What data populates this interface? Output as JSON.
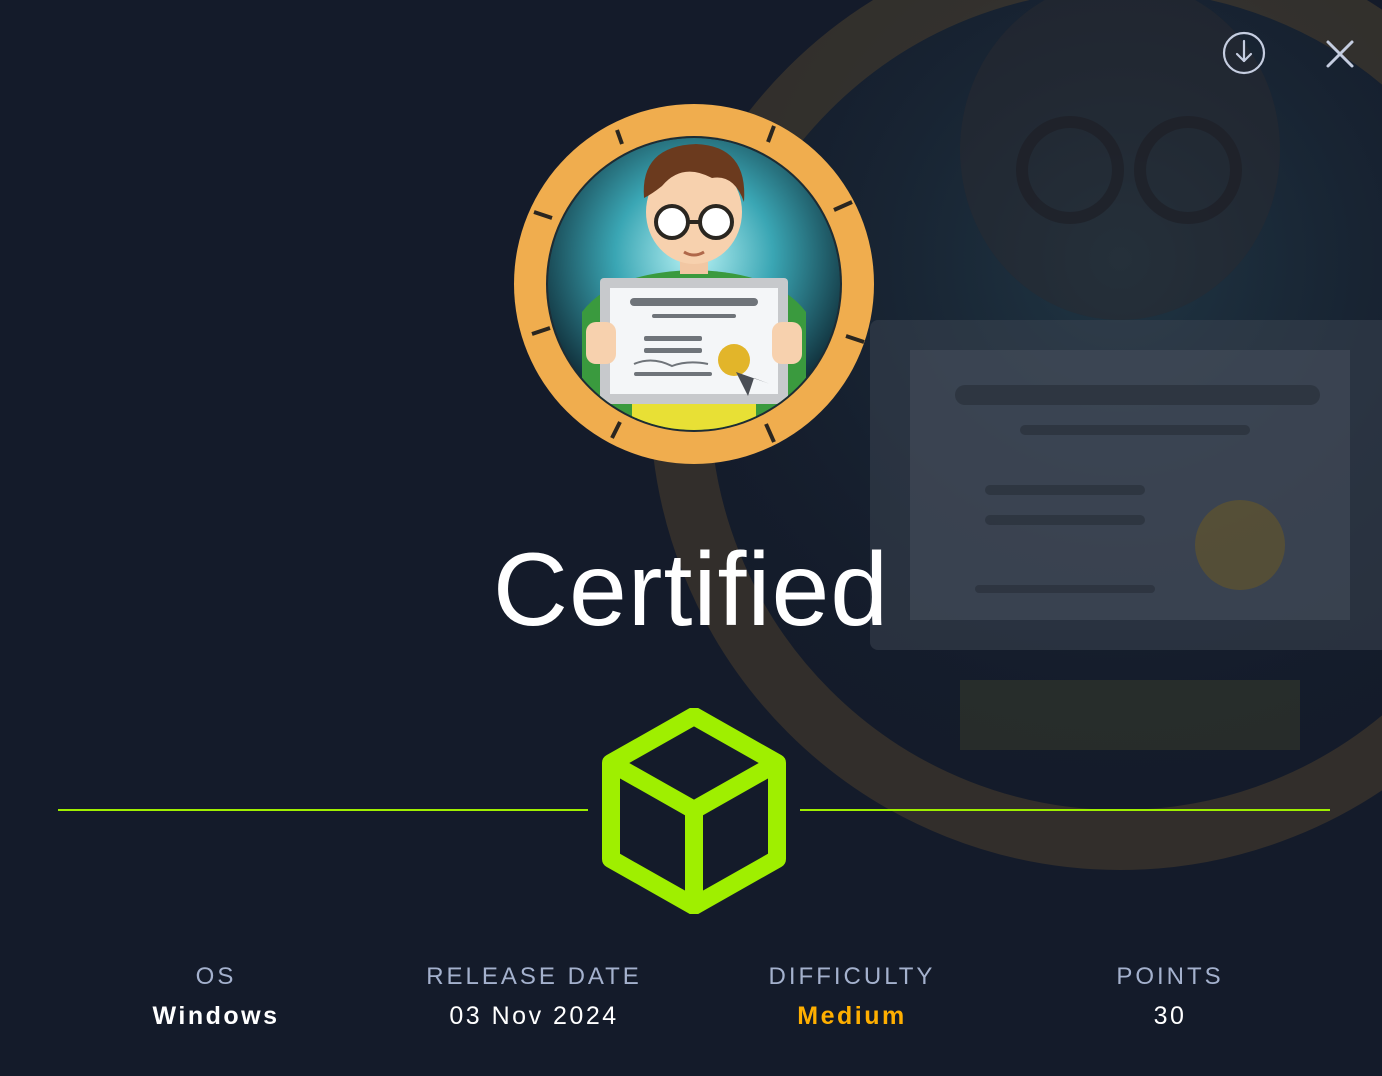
{
  "machine": {
    "name": "Certified"
  },
  "toolbar": {
    "download_icon": "download-circle-icon",
    "close_icon": "close-icon"
  },
  "stats": {
    "os": {
      "label": "OS",
      "value": "Windows"
    },
    "release": {
      "label": "RELEASE DATE",
      "value": "03 Nov 2024"
    },
    "difficulty": {
      "label": "DIFFICULTY",
      "value": "Medium",
      "color": "#ffaf00"
    },
    "points": {
      "label": "POINTS",
      "value": "30"
    }
  },
  "colors": {
    "background": "#141b2a",
    "accent_green": "#9fef00",
    "ring_orange": "#f0ad4e",
    "label_gray": "#a4b1cd"
  }
}
